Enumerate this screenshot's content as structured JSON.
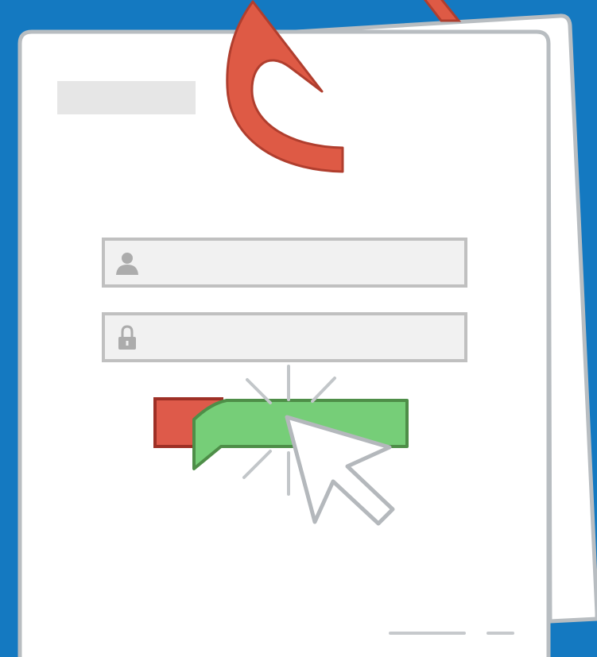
{
  "colors": {
    "background": "#1479C1",
    "page": "#FFFFFF",
    "page_border": "#B8BDC1",
    "title_placeholder": "#E6E6E6",
    "field_fill": "#F1F1F1",
    "field_border": "#C0C0C0",
    "field_icon": "#ACACAC",
    "hook": "#DE5A45",
    "hook_outline": "#B03E2E",
    "red_button": "#DE5A4A",
    "red_button_border": "#9E3026",
    "green_button": "#76CE78",
    "green_button_border": "#4E8E48",
    "cursor": "#FFFFFF",
    "cursor_outline": "#B4B8BC",
    "click_rays": "#C2C6C9",
    "footer_line": "#C6C9CC"
  },
  "icons": {
    "username": "user-icon",
    "password": "lock-icon",
    "pointer": "mouse-pointer-icon",
    "hook": "fishing-hook-icon"
  }
}
